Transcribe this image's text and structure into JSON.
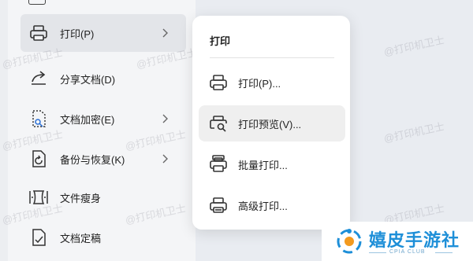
{
  "left_menu": {
    "items": [
      {
        "label": "打印(P)",
        "icon": "printer-icon",
        "has_submenu": true,
        "active": true
      },
      {
        "label": "分享文档(D)",
        "icon": "share-icon",
        "has_submenu": false
      },
      {
        "label": "文档加密(E)",
        "icon": "encrypt-doc-icon",
        "has_submenu": true
      },
      {
        "label": "备份与恢复(K)",
        "icon": "backup-restore-icon",
        "has_submenu": true
      },
      {
        "label": "文件瘦身",
        "icon": "file-slim-icon",
        "has_submenu": false
      },
      {
        "label": "文档定稿",
        "icon": "finalize-doc-icon",
        "has_submenu": false
      }
    ]
  },
  "submenu": {
    "title": "打印",
    "items": [
      {
        "label": "打印(P)...",
        "icon": "printer-icon"
      },
      {
        "label": "打印预览(V)...",
        "icon": "print-preview-icon",
        "hover": true
      },
      {
        "label": "批量打印...",
        "icon": "batch-print-icon"
      },
      {
        "label": "高级打印...",
        "icon": "advanced-print-icon"
      }
    ]
  },
  "watermark": "@打印机卫士",
  "logo": {
    "text": "嬉皮手游社",
    "sub": "CPIA CLUB"
  },
  "colors": {
    "accent": "#1e8fd8",
    "panel": "#f4f5f7",
    "background": "#e9ecf1",
    "active": "#e3e5e9"
  }
}
